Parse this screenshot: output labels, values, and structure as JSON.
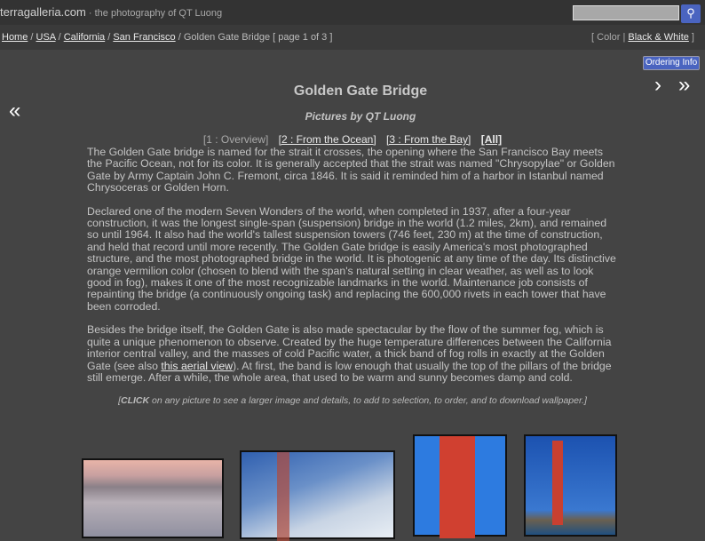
{
  "header": {
    "site": "terragalleria.com",
    "tagline": " · the photography of QT Luong",
    "search_placeholder": "",
    "search_icon": "magnifier-icon"
  },
  "breadcrumb": {
    "items": [
      "Home",
      "USA",
      "California",
      "San Francisco"
    ],
    "current": "Golden Gate Bridge",
    "page": "[ page 1 of 3 ]"
  },
  "mode": {
    "open": "[ ",
    "color": "Color",
    "sep": " | ",
    "bw": "Black & White",
    "close": " ]"
  },
  "ordering": "Ordering Info",
  "nav": {
    "prev_all": "«",
    "next": "›",
    "next_all": "»"
  },
  "title": "Golden Gate Bridge",
  "byline": "Pictures by QT Luong",
  "pages": {
    "current": "[1 : Overview]",
    "links": [
      "[2 : From the Ocean]",
      "[3 : From the Bay]",
      "[All]"
    ]
  },
  "paragraphs": [
    "The Golden Gate bridge is named for the strait it crosses, the opening where the San Francisco Bay meets the Pacific Ocean, not for its color. It is generally accepted that the strait was named \"Chrysopylae\" or Golden Gate by Army Captain John C. Fremont, circa 1846. It is said it reminded him of a harbor in Istanbul named Chrysoceras or Golden Horn.",
    "Declared one of the modern Seven Wonders of the world, when completed in 1937, after a four-year construction, it was the longest single-span (suspension) bridge in the world (1.2 miles, 2km), and remained so until 1964. It also had the world's tallest suspension towers (746 feet, 230 m) at the time of construction, and held that record until more recently. The Golden Gate bridge is easily America's most photographed structure, and the most photographed bridge in the world. It is photogenic at any time of the day. Its distinctive orange vermilion color (chosen to blend with the span's natural setting in clear weather, as well as to look good in fog), makes it one of the most recognizable landmarks in the world. Maintenance job consists of repainting the bridge (a continuously ongoing task) and replacing the 600,000 rivets in each tower that have been corroded."
  ],
  "p3": {
    "before": "Besides the bridge itself, the Golden Gate is also made spectacular by the flow of the summer fog, which is quite a unique phenomenon to observe. Created by the huge temperature differences between the California interior central valley, and the masses of cold Pacific water, a thick band of fog rolls in exactly at the Golden Gate (see also ",
    "link": "this aerial view",
    "after": "). At first, the band is low enough that usually the top of the pillars of the bridge still emerge. After a while, the whole area, that used to be warm and sunny becomes damp and cold."
  },
  "click": {
    "open": "[",
    "bold": "CLICK",
    "rest": " on any picture to see a larger image and details, to add to selection, to order, and to download wallpaper.",
    "close": "]"
  }
}
